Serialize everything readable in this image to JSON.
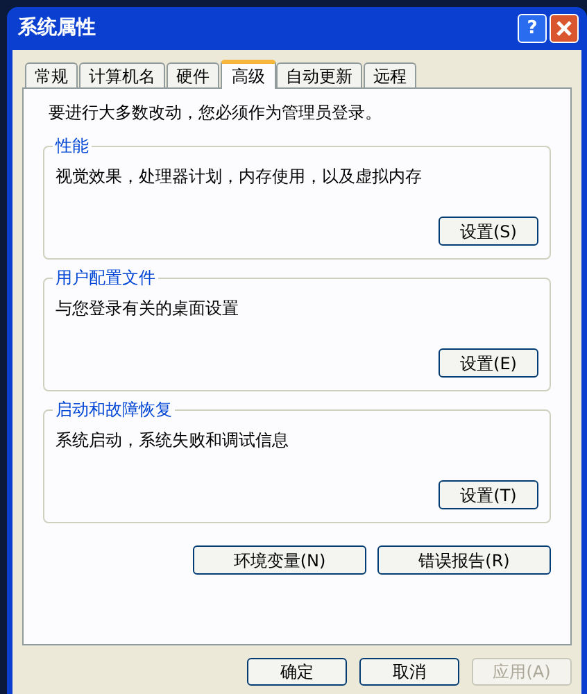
{
  "window": {
    "title": "系统属性",
    "help_button": "?"
  },
  "tabs": [
    {
      "label": "常规",
      "selected": false
    },
    {
      "label": "计算机名",
      "selected": false
    },
    {
      "label": "硬件",
      "selected": false
    },
    {
      "label": "高级",
      "selected": true
    },
    {
      "label": "自动更新",
      "selected": false
    },
    {
      "label": "远程",
      "selected": false
    }
  ],
  "notice": "要进行大多数改动，您必须作为管理员登录。",
  "groups": [
    {
      "title": "性能",
      "description": "视觉效果，处理器计划，内存使用，以及虚拟内存",
      "button": "设置(S)"
    },
    {
      "title": "用户配置文件",
      "description": "与您登录有关的桌面设置",
      "button": "设置(E)"
    },
    {
      "title": "启动和故障恢复",
      "description": "系统启动，系统失败和调试信息",
      "button": "设置(T)"
    }
  ],
  "panel_buttons": [
    "环境变量(N)",
    "错误报告(R)"
  ],
  "dialog_buttons": [
    {
      "label": "确定",
      "disabled": false
    },
    {
      "label": "取消",
      "disabled": false
    },
    {
      "label": "应用(A)",
      "disabled": true
    }
  ]
}
